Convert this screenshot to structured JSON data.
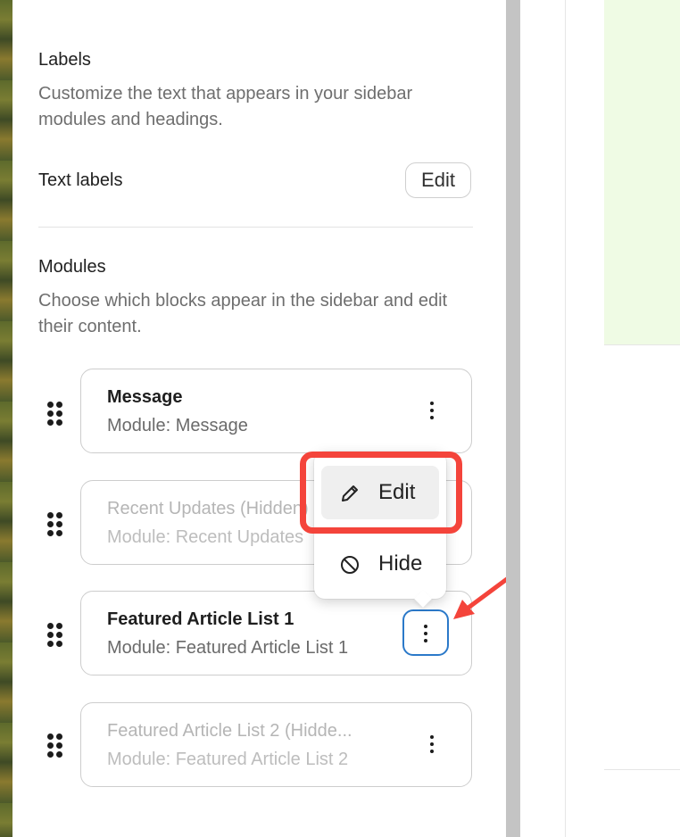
{
  "labels_section": {
    "heading": "Labels",
    "description": "Customize the text that appears in your sidebar modules and headings.",
    "text_labels": "Text labels",
    "edit_button": "Edit"
  },
  "modules_section": {
    "heading": "Modules",
    "description": "Choose which blocks appear in the sidebar and edit their content.",
    "items": [
      {
        "title": "Message",
        "subtitle": "Module: Message",
        "hidden": false
      },
      {
        "title": "Recent Updates (Hidden)",
        "subtitle": "Module: Recent Updates",
        "hidden": true
      },
      {
        "title": "Featured Article List 1",
        "subtitle": "Module: Featured Article List 1",
        "hidden": false
      },
      {
        "title": "Featured Article List 2 (Hidde...",
        "subtitle": "Module: Featured Article List 2",
        "hidden": true
      }
    ]
  },
  "context_menu": {
    "edit_label": "Edit",
    "hide_label": "Hide"
  },
  "colors": {
    "highlight": "#f4443b",
    "focus_ring": "#2b79c9"
  }
}
